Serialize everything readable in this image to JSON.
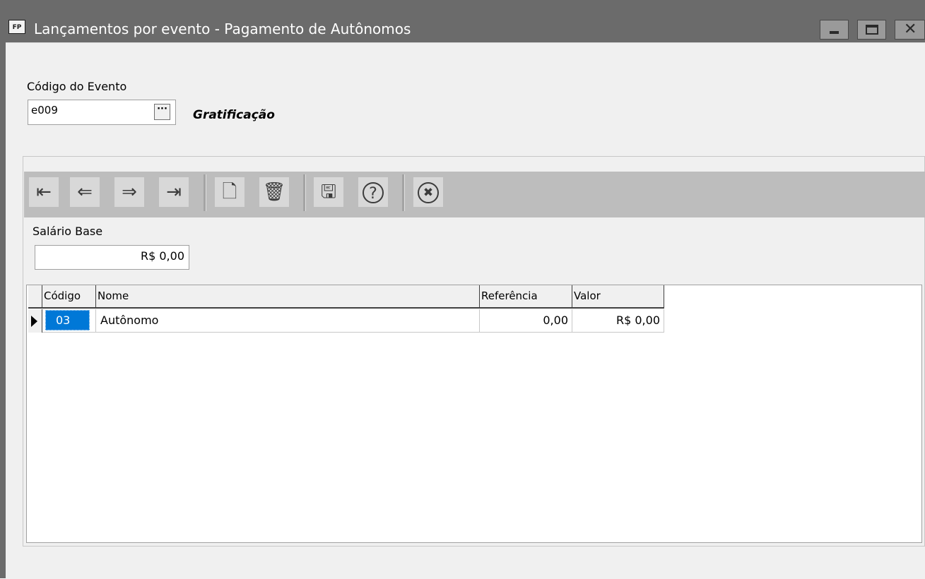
{
  "window": {
    "app_icon_text": "FP",
    "title": "Lançamentos por evento - Pagamento de Autônomos"
  },
  "evento": {
    "label": "Código do Evento",
    "value": "e009",
    "lookup_label": "···",
    "description": "Gratificação"
  },
  "toolbar": {
    "buttons": [
      {
        "icon": "first-record-icon",
        "glyph": "⇤"
      },
      {
        "icon": "previous-record-icon",
        "glyph": "⇐"
      },
      {
        "icon": "next-record-icon",
        "glyph": "⇒"
      },
      {
        "icon": "last-record-icon",
        "glyph": "⇥"
      },
      {
        "icon": "new-document-icon",
        "glyph": "🗋"
      },
      {
        "icon": "delete-trash-icon",
        "glyph": "🗑"
      },
      {
        "icon": "save-disk-icon",
        "glyph": "🖫"
      },
      {
        "icon": "help-icon",
        "glyph": "?"
      },
      {
        "icon": "cancel-icon",
        "glyph": "✖"
      }
    ]
  },
  "salario": {
    "label": "Salário Base",
    "value": "R$ 0,00"
  },
  "grid": {
    "columns": [
      "Código",
      "Nome",
      "Referência",
      "Valor"
    ],
    "rows": [
      {
        "codigo": "03",
        "nome": "Autônomo",
        "referencia": "0,00",
        "valor": "R$ 0,00"
      }
    ]
  },
  "colors": {
    "titlebar": "#6b6b6b",
    "selected_cell": "#0078d7",
    "toolbar_bg": "#bdbdbd"
  }
}
